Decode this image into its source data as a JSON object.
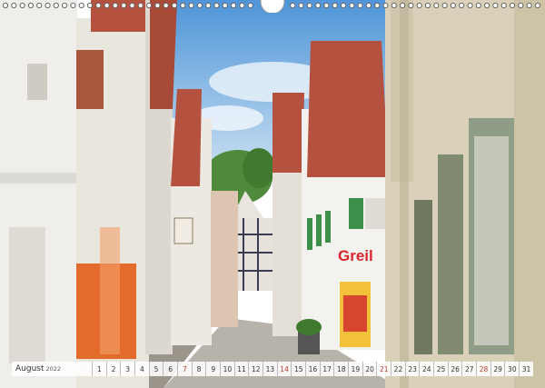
{
  "calendar": {
    "month": "August",
    "year": "2022",
    "days": [
      {
        "n": "1",
        "sun": false
      },
      {
        "n": "2",
        "sun": false
      },
      {
        "n": "3",
        "sun": false
      },
      {
        "n": "4",
        "sun": false
      },
      {
        "n": "5",
        "sun": false
      },
      {
        "n": "6",
        "sun": false
      },
      {
        "n": "7",
        "sun": true
      },
      {
        "n": "8",
        "sun": false
      },
      {
        "n": "9",
        "sun": false
      },
      {
        "n": "10",
        "sun": false
      },
      {
        "n": "11",
        "sun": false
      },
      {
        "n": "12",
        "sun": false
      },
      {
        "n": "13",
        "sun": false
      },
      {
        "n": "14",
        "sun": true
      },
      {
        "n": "15",
        "sun": false
      },
      {
        "n": "16",
        "sun": false
      },
      {
        "n": "17",
        "sun": false
      },
      {
        "n": "18",
        "sun": false
      },
      {
        "n": "19",
        "sun": false
      },
      {
        "n": "20",
        "sun": false
      },
      {
        "n": "21",
        "sun": true
      },
      {
        "n": "22",
        "sun": false
      },
      {
        "n": "23",
        "sun": false
      },
      {
        "n": "24",
        "sun": false
      },
      {
        "n": "25",
        "sun": false
      },
      {
        "n": "26",
        "sun": false
      },
      {
        "n": "27",
        "sun": false
      },
      {
        "n": "28",
        "sun": true
      },
      {
        "n": "29",
        "sun": false
      },
      {
        "n": "30",
        "sun": false
      },
      {
        "n": "31",
        "sun": false
      }
    ]
  },
  "signs": {
    "shop": "Greil"
  },
  "colors": {
    "sky": "#6aa9e0",
    "roof": "#b5523f",
    "sunday": "#c0392b"
  }
}
